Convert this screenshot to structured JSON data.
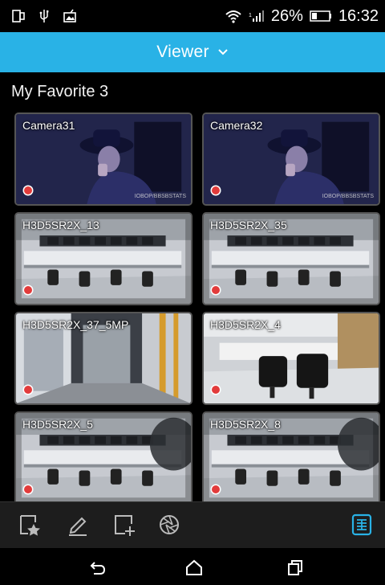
{
  "status_bar": {
    "battery_percent": "26%",
    "time": "16:32",
    "icons": [
      "screen-mirror-icon",
      "usb-icon",
      "photo-notification-icon",
      "wifi-icon",
      "signal-icon",
      "battery-icon"
    ]
  },
  "header": {
    "title": "Viewer",
    "background": "#29b2e6"
  },
  "group": {
    "title": "My Favorite 3"
  },
  "cameras": [
    {
      "name": "Camera31",
      "scene": "person",
      "recording": true,
      "watermark": "IOBOP/BBSBSTATS"
    },
    {
      "name": "Camera32",
      "scene": "person",
      "recording": true,
      "watermark": "IOBOP/BBSBSTATS"
    },
    {
      "name": "H3D5SR2X_13",
      "scene": "control-room",
      "recording": true
    },
    {
      "name": "H3D5SR2X_35",
      "scene": "control-room",
      "recording": true
    },
    {
      "name": "H3D5SR2X_37_5MP",
      "scene": "server-aisle",
      "recording": true
    },
    {
      "name": "H3D5SR2X_4",
      "scene": "office-chairs",
      "recording": true
    },
    {
      "name": "H3D5SR2X_5",
      "scene": "control-room-wide",
      "recording": true
    },
    {
      "name": "H3D5SR2X_8",
      "scene": "control-room-wide",
      "recording": true
    }
  ],
  "toolbar": {
    "buttons": [
      "favorite-add-icon",
      "edit-icon",
      "add-view-icon",
      "aperture-icon",
      "layout-grid-icon"
    ],
    "active_color": "#29b2e6"
  },
  "navbar": {
    "buttons": [
      "back-icon",
      "home-icon",
      "recents-icon"
    ]
  }
}
